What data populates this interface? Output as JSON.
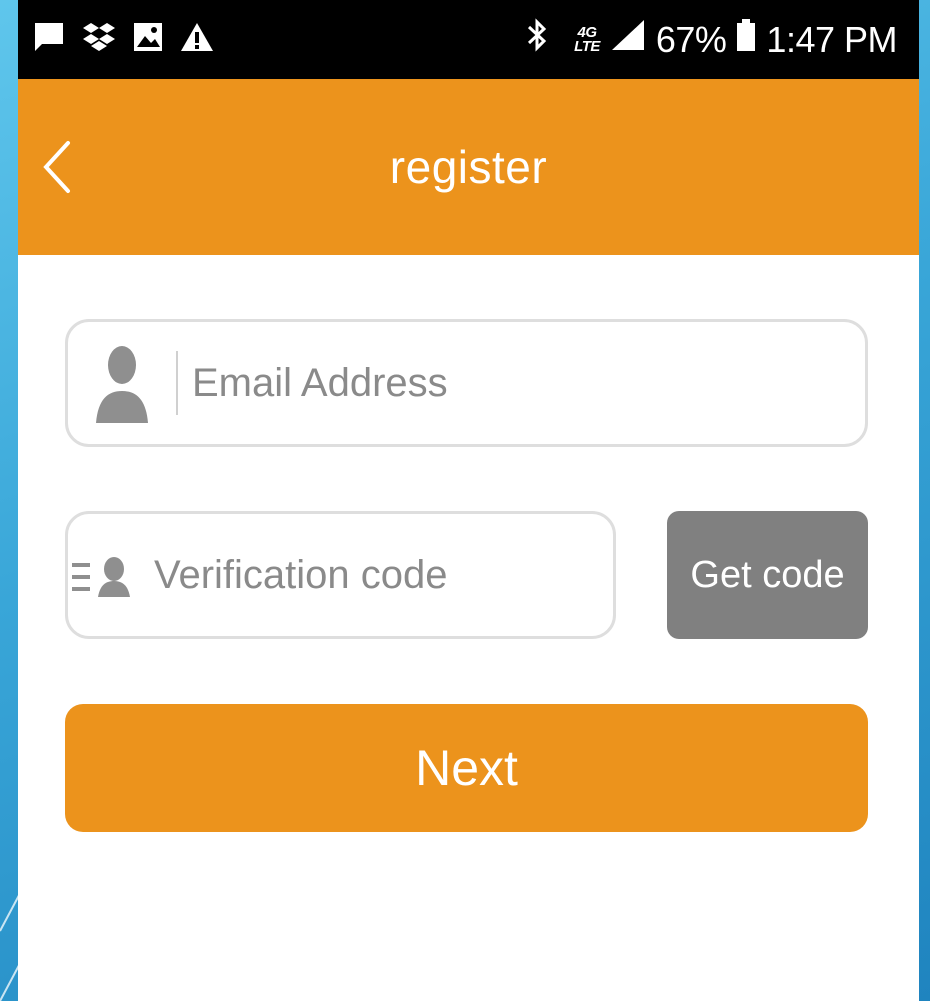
{
  "status_bar": {
    "battery": "67%",
    "time": "1:47 PM",
    "network_type": "4G",
    "network_sub": "LTE"
  },
  "header": {
    "title": "register"
  },
  "form": {
    "email": {
      "value": "",
      "placeholder": "Email Address"
    },
    "code": {
      "value": "",
      "placeholder": "Verification code"
    },
    "get_code_label": "Get code",
    "next_label": "Next"
  },
  "colors": {
    "accent": "#ec931c",
    "get_code_bg": "#808080",
    "background_blue": "#39a6d8"
  },
  "icons": [
    "chat-bubble-icon",
    "dropbox-icon",
    "image-icon",
    "warning-icon",
    "bluetooth-icon",
    "signal-icon",
    "battery-icon",
    "back-chevron-icon",
    "user-icon",
    "id-card-icon"
  ]
}
